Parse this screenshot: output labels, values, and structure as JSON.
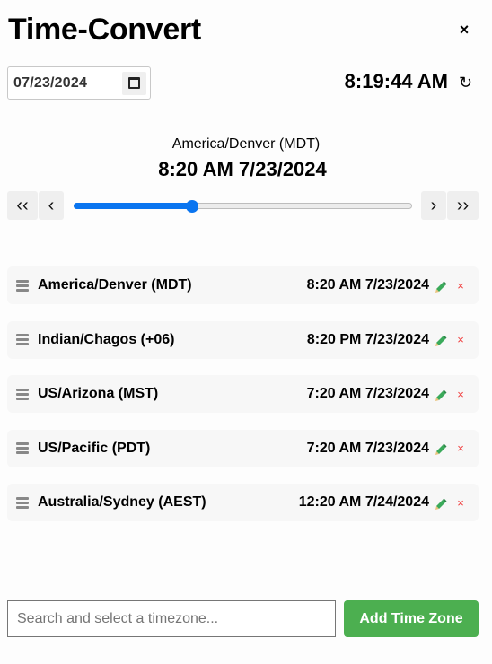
{
  "header": {
    "title": "Time-Convert",
    "close_label": "×"
  },
  "controls": {
    "date_value": "07/23/2024",
    "current_time": "8:19:44 AM",
    "refresh_label": "↻"
  },
  "reference": {
    "zone": "America/Denver (MDT)",
    "time": "8:20 AM 7/23/2024"
  },
  "navigation": {
    "back_far_label": "‹‹",
    "back_label": "‹",
    "forward_label": "›",
    "forward_far_label": "››",
    "slider_fraction": 0.35
  },
  "zones": [
    {
      "name": "America/Denver (MDT)",
      "time": "8:20 AM 7/23/2024"
    },
    {
      "name": "Indian/Chagos (+06)",
      "time": "8:20 PM 7/23/2024"
    },
    {
      "name": "US/Arizona (MST)",
      "time": "7:20 AM 7/23/2024"
    },
    {
      "name": "US/Pacific (PDT)",
      "time": "7:20 AM 7/23/2024"
    },
    {
      "name": "Australia/Sydney (AEST)",
      "time": "12:20 AM 7/24/2024"
    }
  ],
  "row_icons": {
    "edit": "pencil-icon",
    "delete": "×"
  },
  "footer": {
    "search_placeholder": "Search and select a timezone...",
    "search_value": "",
    "add_label": "Add Time Zone"
  },
  "colors": {
    "accent": "#0a75f0",
    "add_button": "#4caf50",
    "delete": "#f03c3c",
    "edit": "#3aaa5a"
  }
}
